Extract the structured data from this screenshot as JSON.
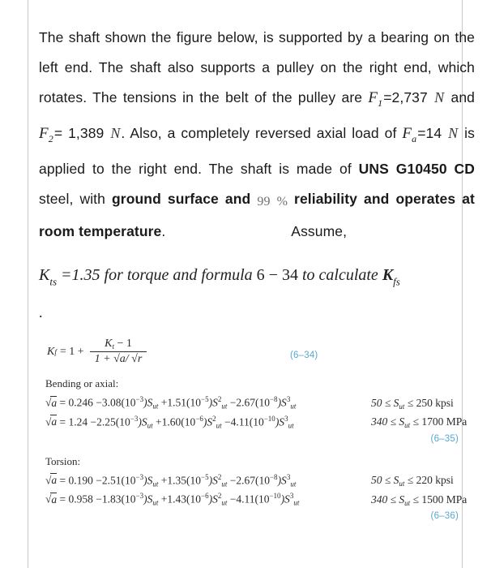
{
  "document": {
    "type": "textbook-problem-scan",
    "accent_color": "#57a7d4",
    "rule_color": "#c9c9c9"
  },
  "statement": {
    "part1": "The shaft shown the figure below, is supported by a bearing on the left end. The shaft also supports a pulley on the right end, which rotates. The tensions in the belt of the pulley are ",
    "F1_symbol": "F",
    "F1_sub": "1",
    "F1_eq_value": "=2,737",
    "unit_N_1": "N",
    "and_1": " and ",
    "F2_symbol": "F",
    "F2_sub": "2",
    "F2_eq": "=",
    "F2_value": "1,389 ",
    "unit_N_2": "N",
    "part2": ". Also, a completely reversed axial load of ",
    "Fa_symbol": "F",
    "Fa_sub": "a",
    "Fa_eq_value": "=14",
    "unit_N_3": "N",
    "part3": " is applied to the right end. The shaft is made of ",
    "material": "UNS G10450 CD",
    "part4": " steel, with ",
    "bold1": "ground surface and ",
    "reliability_value": "99",
    "reliability_unit": "%",
    "bold2": " reliability and operates at room temperature",
    "part5": ".",
    "assume_word": "Assume,"
  },
  "assume": {
    "K_symbol": "K",
    "K_sub": "ts",
    "eq_value": "=1.35",
    "text1": "for torque and formula",
    "eq_ref": "6 − 34",
    "text2": "to calculate",
    "Kfs_symbol": "K",
    "Kfs_sub": "fs",
    "trailing_dot": "."
  },
  "book": {
    "kf_equation": {
      "lhs_K": "K",
      "lhs_sub": "f",
      "eq": "= 1 +",
      "numerator_K": "K",
      "numerator_sub": "t",
      "numerator_rest": "− 1",
      "denominator": "1 +  √a/ √r",
      "eqnum": "(6–34)"
    },
    "bending_section": {
      "label": "Bending or axial:",
      "rows": [
        {
          "expr": "√a = 0.246 − 3.08(10⁻³)Sᵤₜ + 1.51(10⁻⁵)S²ᵤₜ − 2.67(10⁻⁸)S³ᵤₜ",
          "expr_parts": {
            "lhs": "a",
            "c0": "= 0.246",
            "t1_sign": "−",
            "t1_coef": "3.08(10",
            "t1_exp": "−3",
            "t1_close": ")S",
            "t1_sub": "ut",
            "t2_sign": "+",
            "t2_coef": "1.51(10",
            "t2_exp": "−5",
            "t2_close": ")S",
            "t2_sup": "2",
            "t2_sub": "ut",
            "t3_sign": "−",
            "t3_coef": "2.67(10",
            "t3_exp": "−8",
            "t3_close": ")S",
            "t3_sup": "3",
            "t3_sub": "ut"
          },
          "range": "50 ≤ S",
          "range_sub": "ut",
          "range_end": "≤ 250 kpsi"
        },
        {
          "expr_parts": {
            "lhs": "a",
            "c0": "= 1.24",
            "t1_sign": "−",
            "t1_coef": "2.25(10",
            "t1_exp": "−3",
            "t1_close": ")S",
            "t1_sub": "ut",
            "t2_sign": "+",
            "t2_coef": "1.60(10",
            "t2_exp": "−6",
            "t2_close": ")S",
            "t2_sup": "2",
            "t2_sub": "ut",
            "t3_sign": "−",
            "t3_coef": "4.11(10",
            "t3_exp": "−10",
            "t3_close": ")S",
            "t3_sup": "3",
            "t3_sub": "ut"
          },
          "range": "340 ≤ S",
          "range_sub": "ut",
          "range_end": "≤ 1700 MPa"
        }
      ],
      "eqnum": "(6–35)"
    },
    "torsion_section": {
      "label": "Torsion:",
      "rows": [
        {
          "expr_parts": {
            "lhs": "a",
            "c0": "= 0.190",
            "t1_sign": "−",
            "t1_coef": "2.51(10",
            "t1_exp": "−3",
            "t1_close": ")S",
            "t1_sub": "ut",
            "t2_sign": "+",
            "t2_coef": "1.35(10",
            "t2_exp": "−5",
            "t2_close": ")S",
            "t2_sup": "2",
            "t2_sub": "ut",
            "t3_sign": "−",
            "t3_coef": "2.67(10",
            "t3_exp": "−8",
            "t3_close": ")S",
            "t3_sup": "3",
            "t3_sub": "ut"
          },
          "range": "50 ≤ S",
          "range_sub": "ut",
          "range_end": "≤ 220 kpsi"
        },
        {
          "expr_parts": {
            "lhs": "a",
            "c0": "= 0.958",
            "t1_sign": "−",
            "t1_coef": "1.83(10",
            "t1_exp": "−3",
            "t1_close": ")S",
            "t1_sub": "ut",
            "t2_sign": "+",
            "t2_coef": "1.43(10",
            "t2_exp": "−6",
            "t2_close": ")S",
            "t2_sup": "2",
            "t2_sub": "ut",
            "t3_sign": "−",
            "t3_coef": "4.11(10",
            "t3_exp": "−10",
            "t3_close": ")S",
            "t3_sup": "3",
            "t3_sub": "ut"
          },
          "range": "340 ≤ S",
          "range_sub": "ut",
          "range_end": "≤ 1500 MPa"
        }
      ],
      "eqnum": "(6–36)"
    }
  }
}
